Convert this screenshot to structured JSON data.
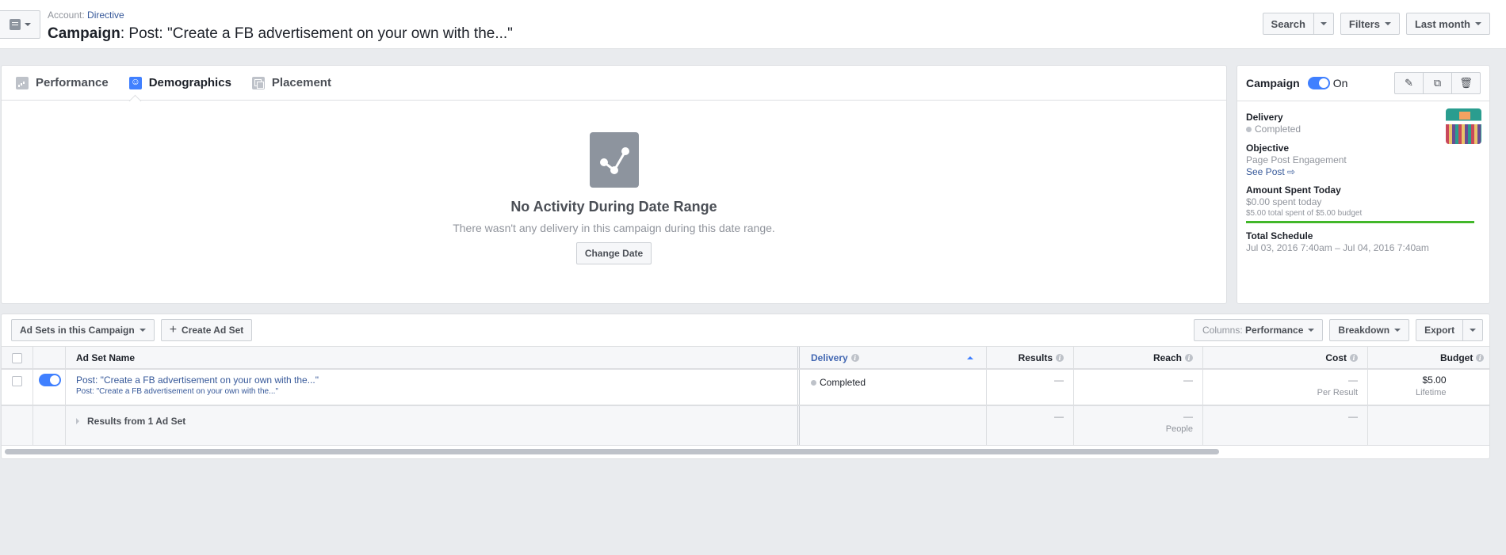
{
  "header": {
    "account_label": "Account:",
    "account_name": "Directive",
    "campaign_label": "Campaign",
    "campaign_name": ": Post: \"Create a FB advertisement on your own with the...\"",
    "search_label": "Search",
    "filters_label": "Filters",
    "date_range_label": "Last month"
  },
  "tabs": [
    {
      "label": "Performance",
      "icon": "bar-chart-icon",
      "active": false
    },
    {
      "label": "Demographics",
      "icon": "people-icon",
      "active": true
    },
    {
      "label": "Placement",
      "icon": "placement-icon",
      "active": false
    }
  ],
  "empty_state": {
    "icon": "line-chart-icon",
    "title": "No Activity During Date Range",
    "message": "There wasn't any delivery in this campaign during this date range.",
    "button_label": "Change Date"
  },
  "side_panel": {
    "title": "Campaign",
    "toggle_state": "On",
    "actions": [
      "edit-icon",
      "duplicate-icon",
      "delete-icon"
    ],
    "delivery_label": "Delivery",
    "delivery_value": "Completed",
    "objective_label": "Objective",
    "objective_value": "Page Post Engagement",
    "see_post_label": "See Post",
    "amount_label": "Amount Spent Today",
    "amount_today": "$0.00 spent today",
    "amount_total": "$5.00 total spent of $5.00 budget",
    "budget_spent_fraction": 1.0,
    "schedule_label": "Total Schedule",
    "schedule_value": "Jul 03, 2016 7:40am – Jul 04, 2016 7:40am",
    "accent_color": "#42b72a"
  },
  "table_toolbar": {
    "view_label": "Ad Sets in this Campaign",
    "create_label": "Create Ad Set",
    "columns_prefix": "Columns:",
    "columns_value": "Performance",
    "breakdown_label": "Breakdown",
    "export_label": "Export"
  },
  "table": {
    "columns": [
      "Ad Set Name",
      "Delivery",
      "Results",
      "Reach",
      "Cost",
      "Budget"
    ],
    "rows": [
      {
        "name": "Post: \"Create a FB advertisement on your own with the...\"",
        "sub_name": "Post: \"Create a FB advertisement on your own with the...\"",
        "delivery": "Completed",
        "results": "—",
        "reach": "—",
        "cost": "—",
        "cost_sub": "Per Result",
        "budget": "$5.00",
        "budget_sub": "Lifetime",
        "enabled": true
      }
    ],
    "summary": {
      "label": "Results from 1 Ad Set",
      "results": "—",
      "reach": "—",
      "reach_sub": "People",
      "cost": "—"
    }
  }
}
